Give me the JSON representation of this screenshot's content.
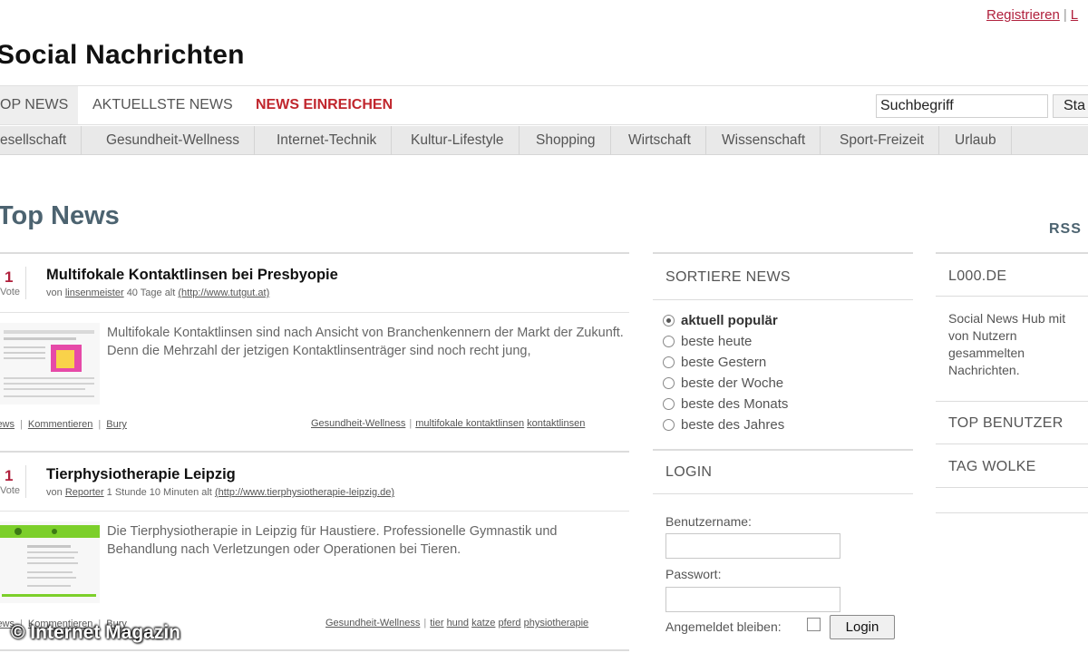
{
  "top_links": {
    "register": "Registrieren",
    "login_partial": "L"
  },
  "site_title": "Social Nachrichten",
  "main_nav": {
    "tabs": [
      "OP NEWS",
      "AKTUELLSTE NEWS",
      "NEWS EINREICHEN"
    ],
    "search_value": "Suchbegriff",
    "search_button": "Sta"
  },
  "categories": [
    "esellschaft",
    "Gesundheit-Wellness",
    "Internet-Technik",
    "Kultur-Lifestyle",
    "Shopping",
    "Wirtschaft",
    "Wissenschaft",
    "Sport-Freizeit",
    "Urlaub"
  ],
  "page_heading": "Top News",
  "rss": "RSS",
  "news": [
    {
      "votes": "1",
      "vote_label": "Vote",
      "title": "Multifokale Kontaktlinsen bei Presbyopie",
      "meta_prefix": "von",
      "author": "linsenmeister",
      "age": "40 Tage alt",
      "url": "(http://www.tutgut.at)",
      "text": "Multifokale Kontaktlinsen sind nach Ansicht von Branchenkennern der Markt der Zukunft. Denn die Mehrzahl der jetzigen Kontaktlinsenträger sind noch recht jung,",
      "actions": [
        "iews",
        "Kommentieren",
        "Bury"
      ],
      "category": "Gesundheit-Wellness",
      "tags": [
        "multifokale kontaktlinsen",
        "kontaktlinsen"
      ]
    },
    {
      "votes": "1",
      "vote_label": "Vote",
      "title": "Tierphysiotherapie Leipzig",
      "meta_prefix": "von",
      "author": "Reporter",
      "age": "1 Stunde 10 Minuten alt",
      "url": "(http://www.tierphysiotherapie-leipzig.de)",
      "text": "Die Tierphysiotherapie in Leipzig für Haustiere. Professionelle Gymnastik und Behandlung nach Verletzungen oder Operationen bei Tieren.",
      "actions": [
        "iews",
        "Kommentieren",
        "Bury"
      ],
      "category": "Gesundheit-Wellness",
      "tags": [
        "tier",
        "hund",
        "katze",
        "pferd",
        "physiotherapie"
      ]
    }
  ],
  "sort_box": {
    "title": "SORTIERE NEWS",
    "options": [
      "aktuell populär",
      "beste heute",
      "beste Gestern",
      "beste der Woche",
      "beste des Monats",
      "beste des Jahres"
    ],
    "selected_index": 0
  },
  "login_box": {
    "title": "LOGIN",
    "username_label": "Benutzername:",
    "password_label": "Passwort:",
    "remember_label": "Angemeldet bleiben:",
    "button": "Login"
  },
  "right_boxes": {
    "site_title": "L000.DE",
    "site_text": "Social News Hub mit von Nutzern gesammelten Nachrichten.",
    "top_users": "TOP BENUTZER",
    "tag_cloud": "TAG WOLKE"
  },
  "watermark": "© Internet Magazin"
}
